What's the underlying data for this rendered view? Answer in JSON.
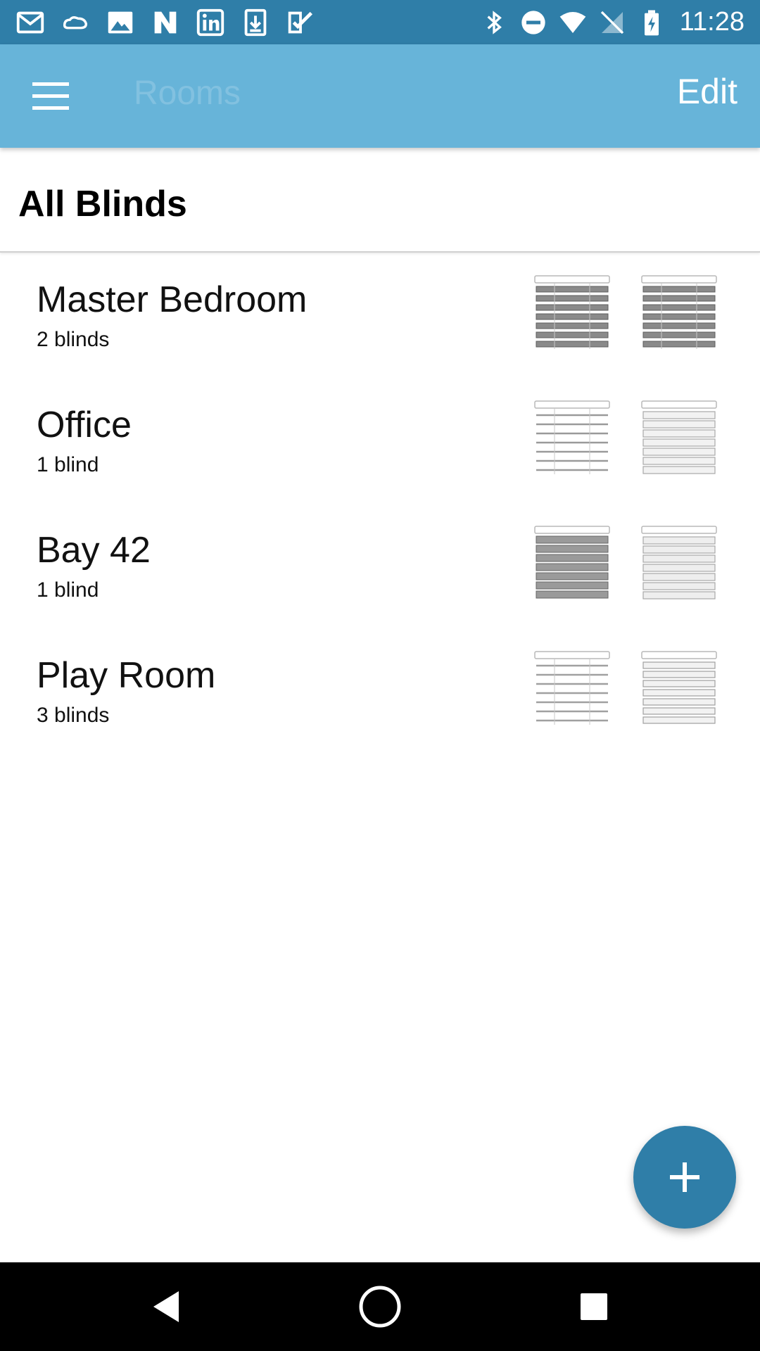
{
  "status_bar": {
    "time": "11:28",
    "left_icons": [
      "gmail-icon",
      "cloud-icon",
      "photos-icon",
      "n-app-icon",
      "linkedin-icon",
      "download-icon",
      "task-check-icon"
    ],
    "right_icons": [
      "bluetooth-icon",
      "do-not-disturb-icon",
      "wifi-icon",
      "no-signal-icon",
      "battery-charging-icon"
    ]
  },
  "app_bar": {
    "title": "Rooms",
    "edit_label": "Edit"
  },
  "section": {
    "title": "All Blinds"
  },
  "rooms": [
    {
      "name": "Master Bedroom",
      "count": "2 blinds"
    },
    {
      "name": "Office",
      "count": "1 blind"
    },
    {
      "name": "Bay 42",
      "count": "1 blind"
    },
    {
      "name": "Play Room",
      "count": "3 blinds"
    }
  ],
  "colors": {
    "status_bar": "#2f7ea8",
    "app_bar": "#67b4d9",
    "fab": "#2f7ea8",
    "nav_bar": "#000000"
  }
}
